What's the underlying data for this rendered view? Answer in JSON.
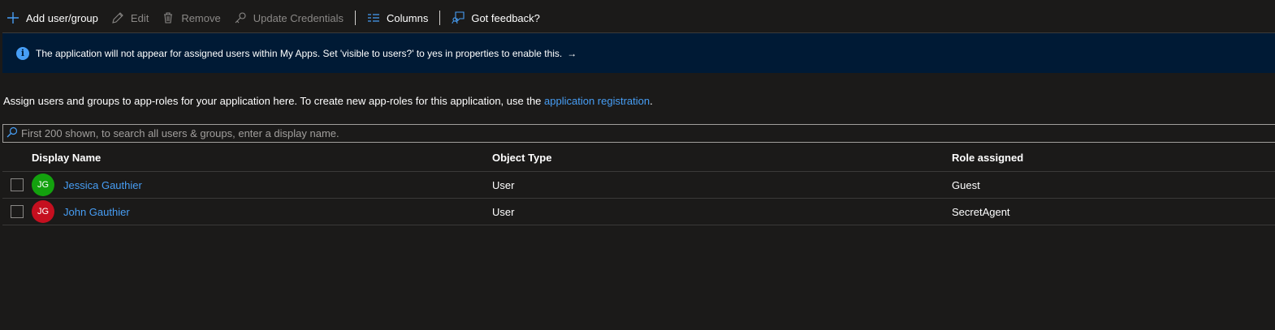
{
  "toolbar": {
    "add_label": "Add user/group",
    "edit_label": "Edit",
    "remove_label": "Remove",
    "update_credentials_label": "Update Credentials",
    "columns_label": "Columns",
    "feedback_label": "Got feedback?"
  },
  "banner": {
    "message": "The application will not appear for assigned users within My Apps. Set 'visible to users?' to yes in properties to enable this.",
    "arrow": "→",
    "info_glyph": "i"
  },
  "description": {
    "text": "Assign users and groups to app-roles for your application here. To create new app-roles for this application, use the ",
    "link": "application registration",
    "suffix": "."
  },
  "search": {
    "placeholder": "First 200 shown, to search all users & groups, enter a display name."
  },
  "table": {
    "headers": {
      "display_name": "Display Name",
      "object_type": "Object Type",
      "role_assigned": "Role assigned"
    },
    "rows": [
      {
        "initials": "JG",
        "avatar_color": "#13a10e",
        "display_name": "Jessica Gauthier",
        "object_type": "User",
        "role_assigned": "Guest"
      },
      {
        "initials": "JG",
        "avatar_color": "#c50f1f",
        "display_name": "John Gauthier",
        "object_type": "User",
        "role_assigned": "SecretAgent"
      }
    ]
  },
  "colors": {
    "accent": "#479ef5",
    "background": "#1b1a19",
    "banner": "#001a35"
  }
}
